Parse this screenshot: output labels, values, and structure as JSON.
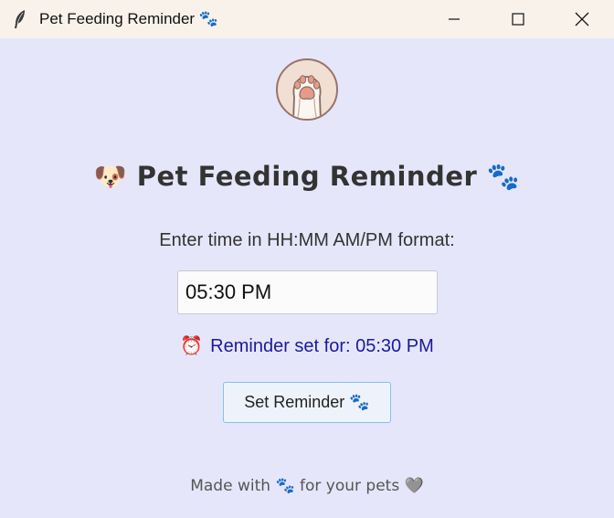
{
  "window": {
    "title": "Pet Feeding Reminder",
    "title_glyph": "🐾"
  },
  "header": {
    "emoji_left": "🐶",
    "title": "Pet Feeding Reminder",
    "emoji_right": "🐾"
  },
  "form": {
    "instruction": "Enter time in HH:MM AM/PM format:",
    "time_value": "05:30 PM",
    "status_icon": "⏰",
    "status_text": "Reminder set for: 05:30 PM",
    "button_label": "Set Reminder",
    "button_glyph": "🐾"
  },
  "footer": {
    "made_with": "Made with",
    "paw": "🐾",
    "for_pets": "for your pets",
    "heart": "🩶"
  },
  "colors": {
    "background": "#e6e6fa",
    "titlebar": "#f8f2ea",
    "status_text": "#1a1a9c",
    "button_border": "#7ec3ea"
  },
  "icons": {
    "app": "feather-icon",
    "logo": "paw-logo-icon",
    "minimize": "minimize-icon",
    "maximize": "maximize-icon",
    "close": "close-icon"
  }
}
